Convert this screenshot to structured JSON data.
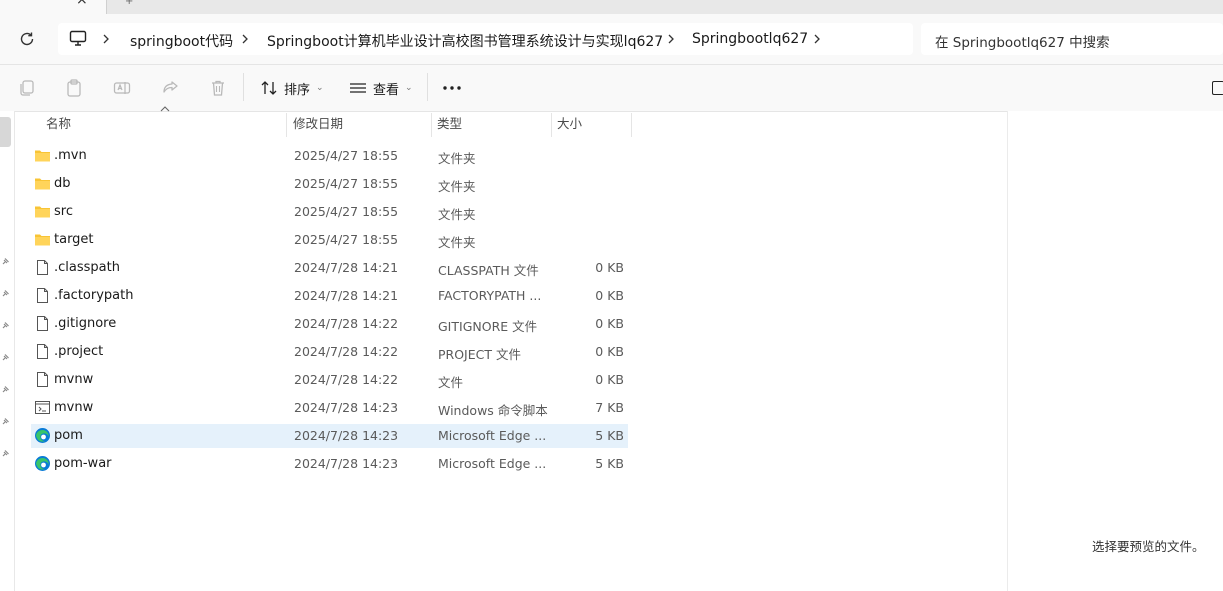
{
  "tabbar": {
    "close_glyph": "×",
    "new_tab_glyph": "+"
  },
  "address": {
    "breadcrumbs": [
      "springboot代码",
      "Springboot计算机毕业设计高校图书管理系统设计与实现lq627",
      "Springbootlq627"
    ],
    "search_placeholder": "在 Springbootlq627 中搜索"
  },
  "toolbar": {
    "sort_label": "排序",
    "view_label": "查看",
    "more_label": "···"
  },
  "columns": {
    "name": "名称",
    "date": "修改日期",
    "type": "类型",
    "size": "大小"
  },
  "files": [
    {
      "name": ".mvn",
      "date": "2025/4/27 18:55",
      "type": "文件夹",
      "size": "",
      "icon": "folder-icon"
    },
    {
      "name": "db",
      "date": "2025/4/27 18:55",
      "type": "文件夹",
      "size": "",
      "icon": "folder-icon"
    },
    {
      "name": "src",
      "date": "2025/4/27 18:55",
      "type": "文件夹",
      "size": "",
      "icon": "folder-icon"
    },
    {
      "name": "target",
      "date": "2025/4/27 18:55",
      "type": "文件夹",
      "size": "",
      "icon": "folder-icon"
    },
    {
      "name": ".classpath",
      "date": "2024/7/28 14:21",
      "type": "CLASSPATH 文件",
      "size": "0 KB",
      "icon": "file-icon"
    },
    {
      "name": ".factorypath",
      "date": "2024/7/28 14:21",
      "type": "FACTORYPATH ...",
      "size": "0 KB",
      "icon": "file-icon"
    },
    {
      "name": ".gitignore",
      "date": "2024/7/28 14:22",
      "type": "GITIGNORE 文件",
      "size": "0 KB",
      "icon": "file-icon"
    },
    {
      "name": ".project",
      "date": "2024/7/28 14:22",
      "type": "PROJECT 文件",
      "size": "0 KB",
      "icon": "file-icon"
    },
    {
      "name": "mvnw",
      "date": "2024/7/28 14:22",
      "type": "文件",
      "size": "0 KB",
      "icon": "file-icon"
    },
    {
      "name": "mvnw",
      "date": "2024/7/28 14:23",
      "type": "Windows 命令脚本",
      "size": "7 KB",
      "icon": "script-icon"
    },
    {
      "name": "pom",
      "date": "2024/7/28 14:23",
      "type": "Microsoft Edge ...",
      "size": "5 KB",
      "icon": "edge-icon",
      "selected": true
    },
    {
      "name": "pom-war",
      "date": "2024/7/28 14:23",
      "type": "Microsoft Edge ...",
      "size": "5 KB",
      "icon": "edge-icon"
    }
  ],
  "preview": {
    "message": "选择要预览的文件。"
  },
  "colors": {
    "selected_row": "#e5f1fb",
    "folder": "#f8c435",
    "edge_blue": "#0a7bd6",
    "edge_green": "#39c56a"
  }
}
